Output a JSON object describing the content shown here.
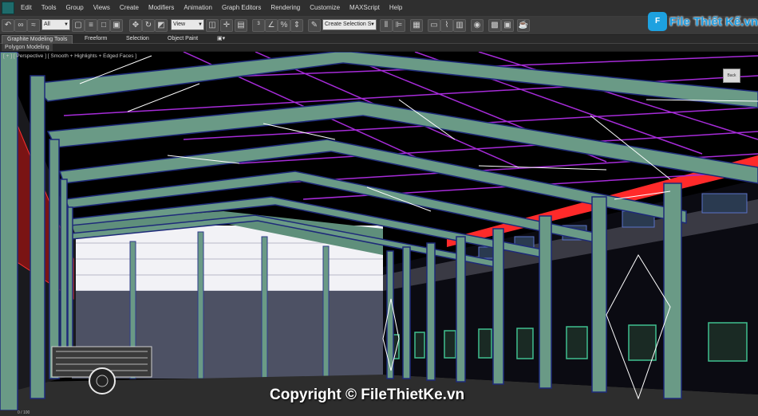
{
  "app": {
    "menus": [
      "Edit",
      "Tools",
      "Group",
      "Views",
      "Create",
      "Modifiers",
      "Animation",
      "Graph Editors",
      "Rendering",
      "Customize",
      "MAXScript",
      "Help"
    ]
  },
  "toolbar": {
    "selection_filter": "All",
    "reference_coord": "View",
    "named_selection": "Create Selection S"
  },
  "ribbon": {
    "tabs": [
      "Graphite Modeling Tools",
      "Freeform",
      "Selection",
      "Object Paint"
    ],
    "panel_label": "Polygon Modeling"
  },
  "viewport": {
    "label": "[ + ] [ Perspective ] [ Smooth + Highlights + Edged Faces ]",
    "viewcube_label": "Back"
  },
  "logo": {
    "mark": "F",
    "text": "File Thiết Kế.vn"
  },
  "watermark": "Copyright © FileThietKe.vn",
  "status": {
    "frame": "0 / 100"
  },
  "colors": {
    "steel": "#6a9a86",
    "purl_magenta": "#a62bd9",
    "accent_red": "#ff2a2a",
    "wall": "#4d5164",
    "floor": "#2d2d2d",
    "window": "#3fbf8f"
  }
}
